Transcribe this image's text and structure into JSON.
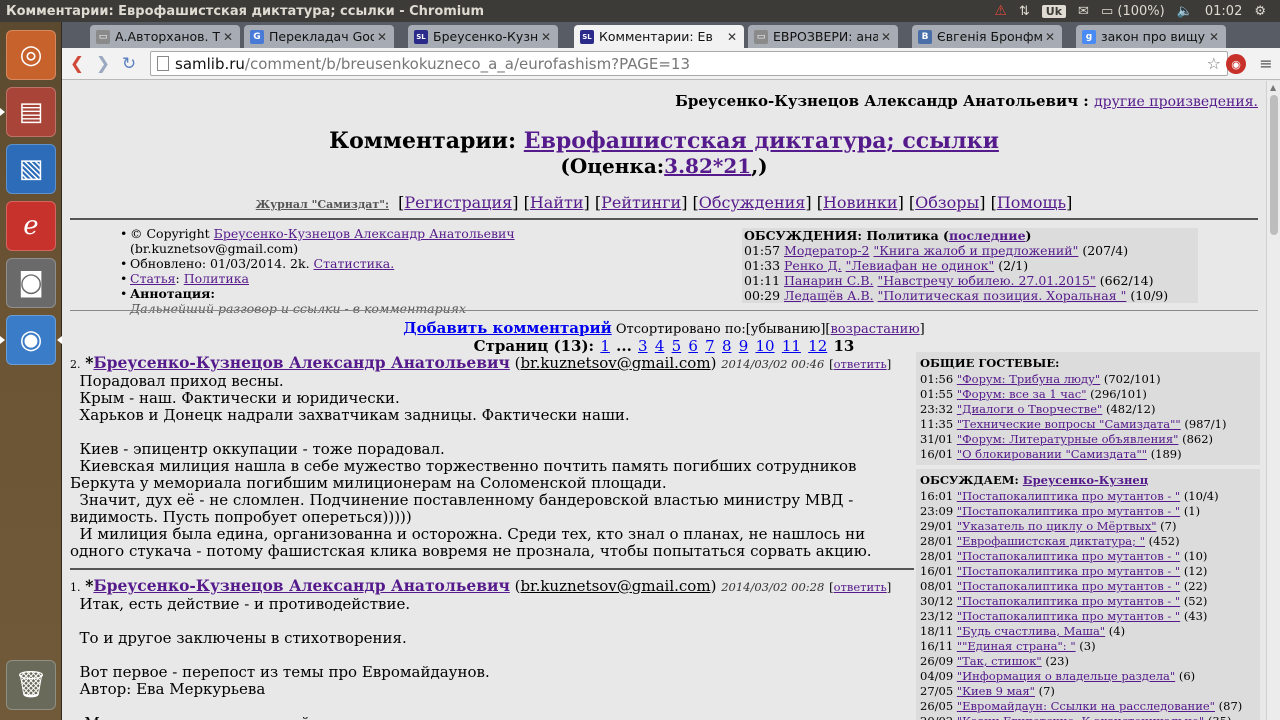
{
  "window": {
    "title": "Комментарии: Еврофашистская диктатура; ссылки - Chromium"
  },
  "tray": {
    "battery": "(100%)",
    "time": "01:02",
    "keyboard": "Uk"
  },
  "tabs": [
    {
      "label": "А.Авторханов. Те",
      "fav": "doc",
      "color": "#8a8a8a"
    },
    {
      "label": "Перекладач Goog",
      "fav": "translate",
      "color": "#4a7ad8"
    },
    {
      "label": "Бреусенко-Кузне",
      "fav": "samlib",
      "color": "#2a2a8a"
    },
    {
      "label": "Комментарии: Ев",
      "fav": "samlib",
      "color": "#2a2a8a"
    },
    {
      "label": "ЕВРОЗВЕРИ: анат",
      "fav": "doc",
      "color": "#8a8a8a"
    },
    {
      "label": "Євгенія Бронфман",
      "fav": "vk",
      "color": "#4a6ea8"
    },
    {
      "label": "закон про вищу о",
      "fav": "google",
      "color": "#4a8af4"
    }
  ],
  "tab_fav_glyphs": {
    "doc": "▭",
    "translate": "G",
    "samlib": "SL",
    "vk": "B",
    "google": "g"
  },
  "url": {
    "host": "samlib.ru",
    "path": "/comment/b/breusenkokuzneco_a_a/eurofashism?PAGE=13"
  },
  "header": {
    "author": "Бреусенко-Кузнецов Александр Анатольевич :",
    "other_works": "другие произведения.",
    "comments_prefix": "Комментарии:",
    "work_title": "Еврофашистская диктатура; ссылки",
    "rating_prefix": "(Оценка:",
    "rating_value": "3.82*21",
    "rating_suffix": ",)"
  },
  "journal": {
    "label": "Журнал \"Самиздат\":",
    "links": [
      "Регистрация",
      "Найти",
      "Рейтинги",
      "Обсуждения",
      "Новинки",
      "Обзоры",
      "Помощь"
    ]
  },
  "info": {
    "copyright_prefix": "© Copyright",
    "copyright_author": "Бреусенко-Кузнецов Александр Анатольевич",
    "email": "(br.kuznetsov@gmail.com)",
    "updated": "Обновлено: 01/03/2014. 2k.",
    "stats": "Статистика.",
    "section": "Статья",
    "section_sep": ":",
    "genre": "Политика",
    "annotation_label": "Аннотация:",
    "annotation": "Дальнейший разговор и ссылки - в комментариях"
  },
  "discussions": {
    "heading": "ОБСУЖДЕНИЯ: Политика (",
    "latest": "последние",
    "heading_end": ")",
    "items": [
      {
        "time": "01:57",
        "who": "Модератор-2",
        "title": "\"Книга жалоб и предложений\"",
        "count": "(207/4)"
      },
      {
        "time": "01:33",
        "who": "Ренко Д.",
        "title": "\"Левиафан не одинок\"",
        "count": "(2/1)"
      },
      {
        "time": "01:11",
        "who": "Панарин С.В.",
        "title": "\"Навстречу юбилею. 27.01.2015\"",
        "count": "(662/14)"
      },
      {
        "time": "00:29",
        "who": "Ледащёв А.В.",
        "title": "\"Политическая позиция. Хоральная \"",
        "count": "(10/9)"
      }
    ]
  },
  "controls": {
    "add_comment": "Добавить комментарий",
    "sorted": "Отсортировано по:[убыванию][",
    "ascending": "возрастанию",
    "sorted_end": "]"
  },
  "pagination": {
    "label": "Страниц (13):",
    "links_a": [
      "1"
    ],
    "ellipsis": "...",
    "links_b": [
      "3",
      "4",
      "5",
      "6",
      "7",
      "8",
      "9",
      "10",
      "11",
      "12"
    ],
    "current": "13"
  },
  "comments": [
    {
      "num": "2.",
      "star": "*",
      "author": "Бреусенко-Кузнецов Александр Анатольевич",
      "email": "br.kuznetsov@gmail.com",
      "date": "2014/03/02 00:46",
      "reply": "ответить",
      "lines": [
        "  Порадовал приход весны.",
        "  Крым - наш. Фактически и юридически.",
        "  Харьков и Донецк надрали захватчикам задницы. Фактически наши.",
        "",
        "  Киев - эпицентр оккупации - тоже порадовал.",
        "  Киевская милиция нашла в себе мужество торжественно почтить память погибших сотрудников Беркута у мемориала погибшим милиционерам на Соломенской площади.",
        "  Значит, дух её - не сломлен. Подчинение поставленному бандеровской властью министру МВД - видимость. Пусть попробует опереться)))))",
        "  И милиция была едина, организованна и осторожна. Среди тех, кто знал о планах, не нашлось ни одного стукача - потому фашистская клика вовремя не прознала, чтобы попытаться сорвать акцию."
      ]
    },
    {
      "num": "1.",
      "star": "*",
      "author": "Бреусенко-Кузнецов Александр Анатольевич",
      "email": "br.kuznetsov@gmail.com",
      "date": "2014/03/02 00:28",
      "reply": "ответить",
      "lines": [
        "  Итак, есть действие - и противодействие.",
        "",
        "  То и другое заключены в стихотворения.",
        "",
        "  Вот первое - перепост из темы про Евромайдаунов.",
        "  Автор: Ева Меркурьева",
        "",
        "   Мирные граждане в мирной столице."
      ]
    }
  ],
  "guestbooks": {
    "heading": "ОБЩИЕ ГОСТЕВЫЕ:",
    "items": [
      {
        "time": "01:56",
        "title": "\"Форум: Трибуна люду\"",
        "count": "(702/101)"
      },
      {
        "time": "01:55",
        "title": "\"Форум: все за 1 час\"",
        "count": "(296/101)"
      },
      {
        "time": "23:32",
        "title": "\"Диалоги о Творчестве\"",
        "count": "(482/12)"
      },
      {
        "time": "11:35",
        "title": "\"Технические вопросы \"Самиздата\"\"",
        "count": "(987/1)"
      },
      {
        "time": "31/01",
        "title": "\"Форум: Литературные объявления\"",
        "count": "(862)"
      },
      {
        "time": "16/01",
        "title": "\"О блокировании \"Самиздата\"\"",
        "count": "(189)"
      }
    ]
  },
  "discuss_author": {
    "heading": "ОБСУЖДАЕМ:",
    "author": "Бреусенко-Кузнец",
    "items": [
      {
        "time": "16:01",
        "title": "\"Постапокалиптика про мутантов - \"",
        "count": "(10/4)"
      },
      {
        "time": "23:09",
        "title": "\"Постапокалиптика про мутантов - \"",
        "count": "(1)"
      },
      {
        "time": "29/01",
        "title": "\"Указатель по циклу о Мёртвых\"",
        "count": "(7)"
      },
      {
        "time": "28/01",
        "title": "\"Еврофашистская диктатура; \"",
        "count": "(452)"
      },
      {
        "time": "28/01",
        "title": "\"Постапокалиптика про мутантов - \"",
        "count": "(10)"
      },
      {
        "time": "16/01",
        "title": "\"Постапокалиптика про мутантов - \"",
        "count": "(12)"
      },
      {
        "time": "08/01",
        "title": "\"Постапокалиптика про мутантов - \"",
        "count": "(22)"
      },
      {
        "time": "30/12",
        "title": "\"Постапокалиптика про мутантов - \"",
        "count": "(52)"
      },
      {
        "time": "23/12",
        "title": "\"Постапокалиптика про мутантов - \"",
        "count": "(43)"
      },
      {
        "time": "18/11",
        "title": "\"Будь счастлива, Маша\"",
        "count": "(4)"
      },
      {
        "time": "16/11",
        "title": "\"\"Единая страна\": \"",
        "count": "(3)"
      },
      {
        "time": "26/09",
        "title": "\"Так, стишок\"",
        "count": "(23)"
      },
      {
        "time": "04/09",
        "title": "\"Информация о владельце раздела\"",
        "count": "(6)"
      },
      {
        "time": "27/05",
        "title": "\"Киев 9 мая\"",
        "count": "(7)"
      },
      {
        "time": "26/05",
        "title": "\"Евромайдаун: Ссылки на расследование\"",
        "count": "(87)"
      },
      {
        "time": "20/02",
        "title": "\"Казни Египетские. К экзистенциально\"",
        "count": "(35)"
      }
    ]
  }
}
